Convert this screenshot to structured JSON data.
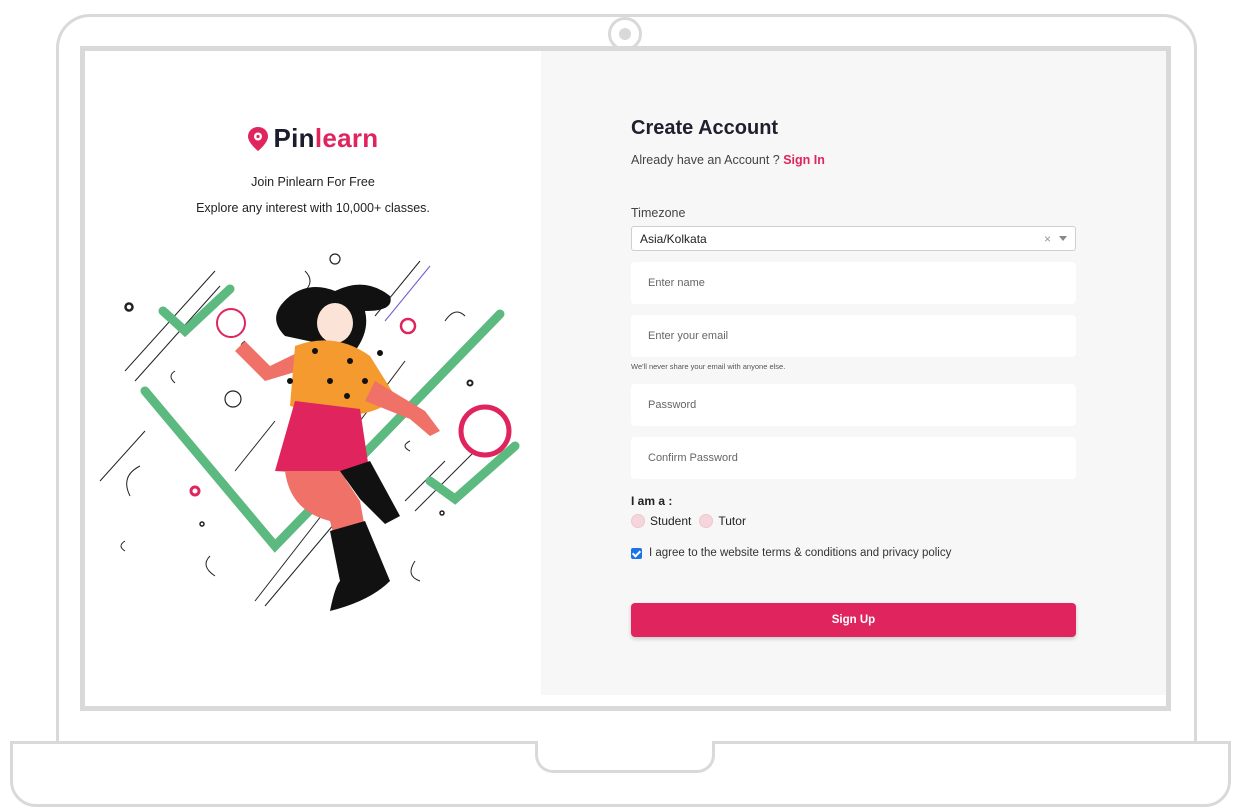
{
  "brand": {
    "name_part1": "Pin",
    "name_part2": "learn",
    "accent_color": "#e0245e",
    "dark_color": "#1c1c2e",
    "icon": "map-pin-icon"
  },
  "hero": {
    "tagline1": "Join Pinlearn For Free",
    "tagline2": "Explore any interest with 10,000+ classes."
  },
  "form": {
    "title": "Create Account",
    "signin_prompt": "Already have an Account ?",
    "signin_link": "Sign In",
    "timezone_label": "Timezone",
    "timezone_value": "Asia/Kolkata",
    "timezone_clear": "×",
    "name_placeholder": "Enter name",
    "email_placeholder": "Enter your email",
    "email_help": "We'll never share your email with anyone else.",
    "password_placeholder": "Password",
    "confirm_placeholder": "Confirm Password",
    "role_label": "I am a :",
    "roles": [
      "Student",
      "Tutor"
    ],
    "terms_text": "I agree to the website terms & conditions and privacy policy",
    "terms_checked": true,
    "submit_label": "Sign Up"
  },
  "colors": {
    "primary": "#e0245e",
    "green": "#5cb97f",
    "orange": "#f59a2f",
    "panel_bg": "#f7f7f7",
    "frame": "#d9d9d9"
  }
}
